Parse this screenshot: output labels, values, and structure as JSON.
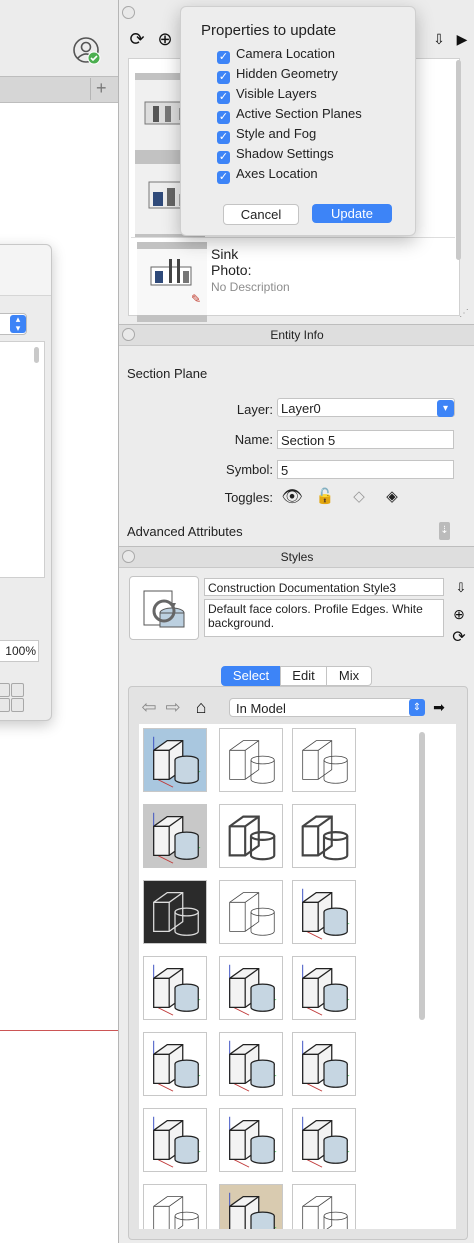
{
  "left_window": {
    "tab_add_label": "+",
    "zoom_percent": "100%"
  },
  "scenes_popover": {
    "title": "Properties to update",
    "options": [
      {
        "label": "Camera Location",
        "checked": true
      },
      {
        "label": "Hidden Geometry",
        "checked": true
      },
      {
        "label": "Visible Layers",
        "checked": true
      },
      {
        "label": "Active Section Planes",
        "checked": true
      },
      {
        "label": "Style and Fog",
        "checked": true
      },
      {
        "label": "Shadow Settings",
        "checked": true
      },
      {
        "label": "Axes Location",
        "checked": true
      }
    ],
    "cancel_label": "Cancel",
    "update_label": "Update"
  },
  "scenes": {
    "selected": {
      "name": "Sink",
      "photo_label": "Photo:",
      "description": "No Description"
    }
  },
  "entity_info": {
    "panel_title": "Entity Info",
    "entity_type": "Section Plane",
    "layer_label": "Layer:",
    "layer_value": "Layer0",
    "name_label": "Name:",
    "name_value": "Section 5",
    "symbol_label": "Symbol:",
    "symbol_value": "5",
    "toggles_label": "Toggles:",
    "advanced_label": "Advanced Attributes"
  },
  "styles": {
    "panel_title": "Styles",
    "style_name": "Construction Documentation Style3",
    "style_description": "Default face colors. Profile Edges. White background.",
    "tabs": [
      "Select",
      "Edit",
      "Mix"
    ],
    "active_tab": "Select",
    "collection": "In Model",
    "swatches": [
      "color-gradient-bg",
      "sketchy-light",
      "sketchy-light",
      "color-gray-bg",
      "sketchy-bold",
      "sketchy-bold",
      "dark-bg-white-lines",
      "sketchy-thin",
      "color-shaded",
      "color-axes",
      "color-axes",
      "color-axes",
      "color-axes",
      "color-axes",
      "color-axes",
      "color-plain",
      "color-plain",
      "color-plain",
      "sketchy-light",
      "color-beige-bg",
      "sketchy-light"
    ]
  },
  "colors": {
    "accent": "#3d84f7",
    "panel_bg": "#ececec"
  }
}
